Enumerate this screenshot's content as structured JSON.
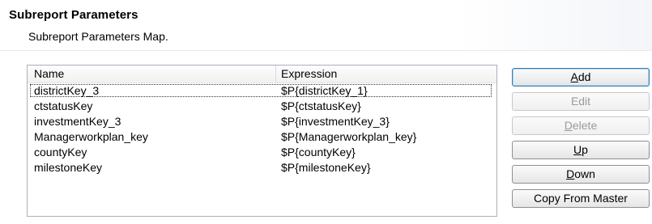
{
  "header": {
    "title": "Subreport Parameters",
    "subtitle": "Subreport Parameters Map."
  },
  "table": {
    "columns": [
      "Name",
      "Expression"
    ],
    "rows": [
      {
        "name": "districtKey_3",
        "expression": "$P{districtKey_1}"
      },
      {
        "name": "ctstatusKey",
        "expression": "$P{ctstatusKey}"
      },
      {
        "name": "investmentKey_3",
        "expression": "$P{investmentKey_3}"
      },
      {
        "name": "Managerworkplan_key",
        "expression": "$P{Managerworkplan_key}"
      },
      {
        "name": "countyKey",
        "expression": "$P{countyKey}"
      },
      {
        "name": "milestoneKey",
        "expression": "$P{milestoneKey}"
      }
    ],
    "selected_row": "districtKey_3"
  },
  "buttons": {
    "add": {
      "mnemonic": "A",
      "rest": "dd"
    },
    "edit": {
      "label": "Edit"
    },
    "delete": {
      "mnemonic": "D",
      "rest": "elete"
    },
    "up": {
      "mnemonic": "U",
      "rest": "p"
    },
    "down": {
      "mnemonic": "D",
      "rest": "own"
    },
    "copy_from_master": {
      "label": "Copy From Master"
    }
  }
}
